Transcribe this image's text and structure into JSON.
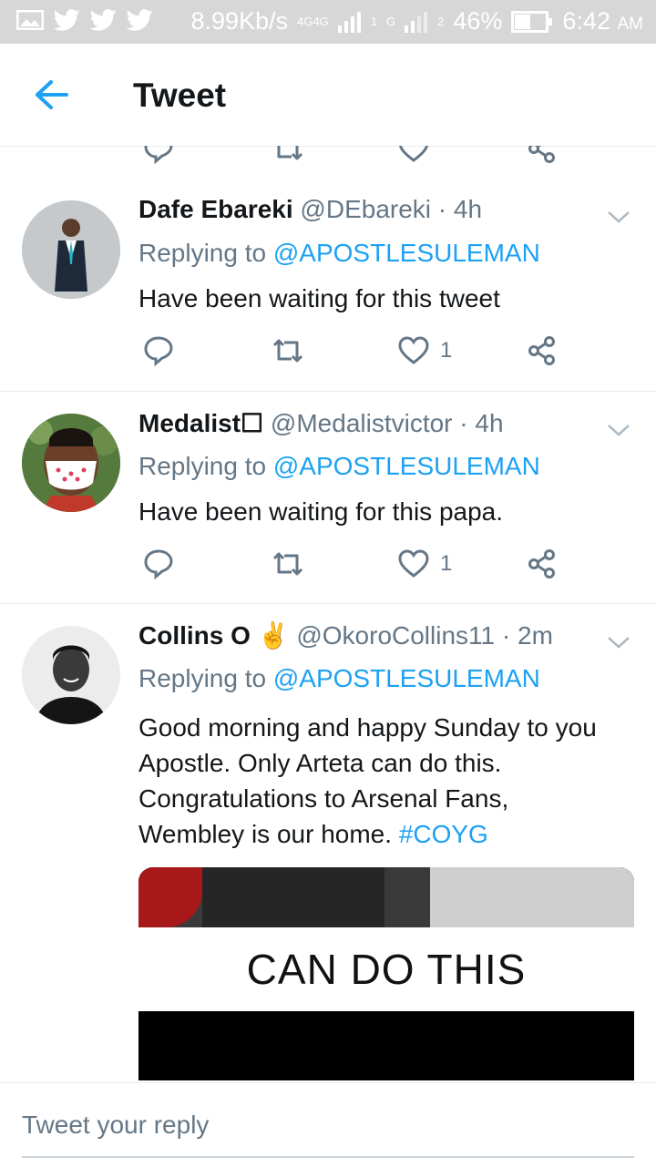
{
  "status_bar": {
    "speed": "8.99Kb/s",
    "network1": "4G",
    "network2": "4G",
    "sim_marker": "G",
    "sim_number": "1",
    "sim2_number": "2",
    "battery": "46%",
    "time": "6:42",
    "ampm": "AM"
  },
  "header": {
    "title": "Tweet",
    "back_icon": "arrow-left-icon"
  },
  "tweets": [
    {
      "name": "Dafe Ebareki",
      "handle": "@DEbareki",
      "separator": "·",
      "time": "4h",
      "replying_prefix": "Replying to",
      "mention": "@APOSTLESULEMAN",
      "text": "Have been waiting for this tweet",
      "likes": "1"
    },
    {
      "name": "Medalist☐",
      "handle": "@Medalistvictor",
      "separator": "·",
      "time": "4h",
      "replying_prefix": "Replying to",
      "mention": "@APOSTLESULEMAN",
      "text": "Have been waiting for this papa.",
      "likes": "1"
    },
    {
      "name": "Collins O",
      "emoji": "✌",
      "handle": "@OkoroCollins11",
      "separator": "·",
      "time": "2m",
      "replying_prefix": "Replying to",
      "mention": "@APOSTLESULEMAN",
      "text_line1": "Good morning and happy Sunday to you",
      "text_line2": "Apostle. Only Arteta can do this.",
      "text_line3": "Congratulations to Arsenal Fans,",
      "text_line4": "Wembley is our home.",
      "hashtag": "#COYG",
      "media_caption": "CAN DO THIS"
    }
  ],
  "reply_box": {
    "placeholder": "Tweet your reply"
  },
  "colors": {
    "accent": "#1da1f2",
    "secondary_text": "#657786",
    "status_bar": "#d7d7d7"
  }
}
